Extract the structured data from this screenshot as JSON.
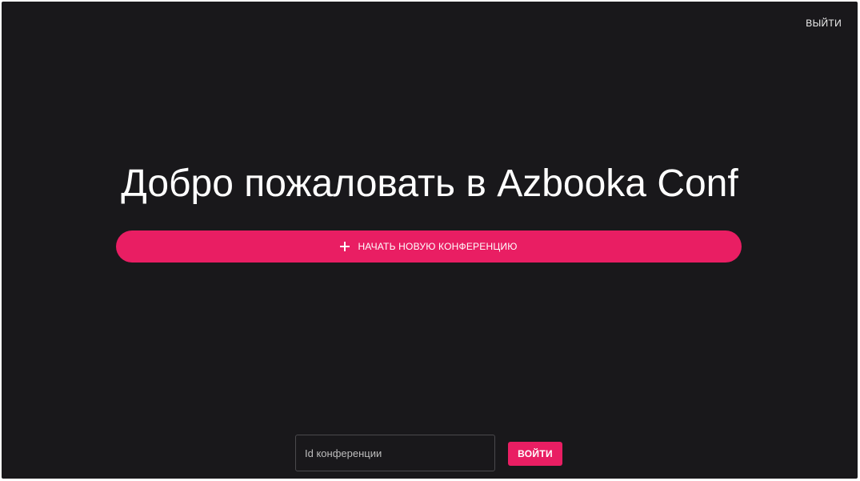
{
  "header": {
    "logout_label": "ВЫЙТИ"
  },
  "main": {
    "title": "Добро пожаловать в Azbooka Conf",
    "new_conference_label": "НАЧАТЬ НОВУЮ КОНФЕРЕНЦИЮ",
    "new_conference_icon": "plus-icon"
  },
  "join": {
    "input_placeholder": "Id конференции",
    "input_value": "",
    "button_label": "ВОЙТИ"
  },
  "colors": {
    "background": "#19181b",
    "accent": "#e91e63",
    "text": "#ffffff"
  }
}
